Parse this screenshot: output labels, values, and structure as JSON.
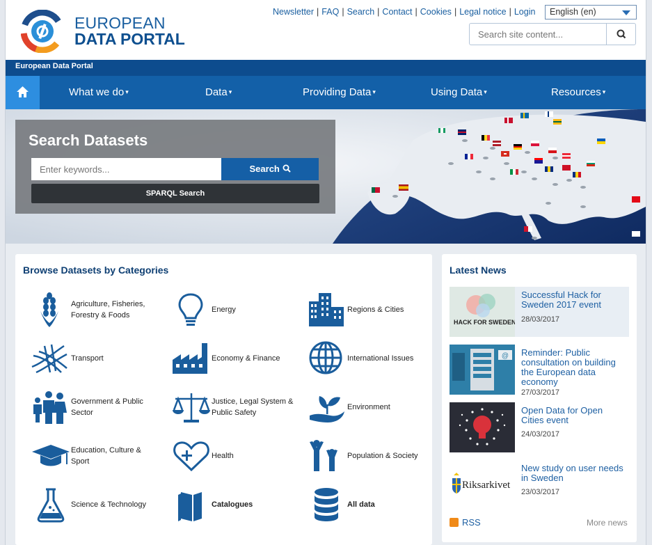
{
  "brand": {
    "line1": "EUROPEAN",
    "line2": "DATA PORTAL",
    "strip": "European Data Portal"
  },
  "toplinks": [
    "Newsletter",
    "FAQ",
    "Search",
    "Contact",
    "Cookies",
    "Legal notice",
    "Login"
  ],
  "language": {
    "selected": "English (en)"
  },
  "site_search": {
    "placeholder": "Search site content..."
  },
  "nav": {
    "items": [
      "What we do",
      "Data",
      "Providing Data",
      "Using Data",
      "Resources"
    ]
  },
  "hero": {
    "title": "Search Datasets",
    "keywords_placeholder": "Enter keywords...",
    "search_label": "Search",
    "sparql_label": "SPARQL Search"
  },
  "categories": {
    "title": "Browse Datasets by Categories",
    "items": [
      {
        "label": "Agriculture, Fisheries, Forestry & Foods",
        "icon": "wheat-icon"
      },
      {
        "label": "Energy",
        "icon": "lightbulb-icon"
      },
      {
        "label": "Regions & Cities",
        "icon": "buildings-icon"
      },
      {
        "label": "Transport",
        "icon": "highway-icon"
      },
      {
        "label": "Economy & Finance",
        "icon": "factory-icon"
      },
      {
        "label": "International Issues",
        "icon": "globe-icon"
      },
      {
        "label": "Government & Public Sector",
        "icon": "family-icon"
      },
      {
        "label": "Justice, Legal System & Public Safety",
        "icon": "scales-icon"
      },
      {
        "label": "Environment",
        "icon": "plant-hand-icon"
      },
      {
        "label": "Education, Culture & Sport",
        "icon": "graduation-cap-icon"
      },
      {
        "label": "Health",
        "icon": "heart-icon"
      },
      {
        "label": "Population & Society",
        "icon": "people-icon"
      },
      {
        "label": "Science & Technology",
        "icon": "flask-icon"
      },
      {
        "label": "Catalogues",
        "icon": "books-icon"
      },
      {
        "label": "All data",
        "icon": "database-icon"
      }
    ]
  },
  "news": {
    "title": "Latest News",
    "items": [
      {
        "title": "Successful Hack for Sweden 2017 event",
        "date": "28/03/2017",
        "thumb_text": "HACK FOR SWEDEN"
      },
      {
        "title": "Reminder: Public consultation on building the European data economy",
        "date": "27/03/2017"
      },
      {
        "title": "Open Data for Open Cities event",
        "date": "24/03/2017"
      },
      {
        "title": "New study on user needs in Sweden",
        "date": "23/03/2017",
        "thumb_text": "Riksarkivet"
      }
    ],
    "rss": "RSS",
    "more": "More news"
  },
  "colors": {
    "primary": "#1360a8",
    "dark": "#0d4c8e",
    "accent": "#2d8ee0",
    "icon": "#1a5d9c"
  }
}
